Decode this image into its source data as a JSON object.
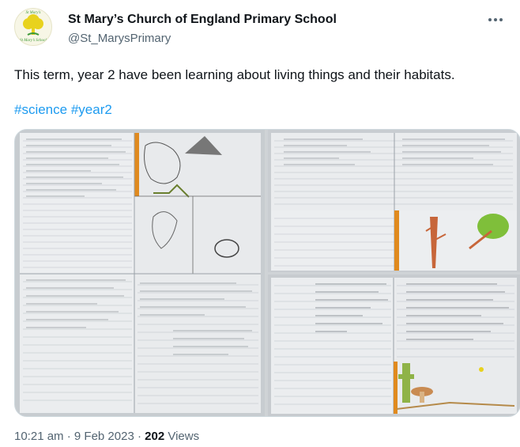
{
  "author": {
    "display_name": "St Mary’s Church of England Primary School",
    "handle": "@St_MarysPrimary",
    "avatar_text_top": "St Mary’s",
    "avatar_text_bottom": "St Mary’s School"
  },
  "post": {
    "text": "This term, year 2 have been learning about living things and their habitats.",
    "hashtags": [
      "#science",
      "#year2"
    ]
  },
  "meta": {
    "time": "10:21 am",
    "separator": "·",
    "date": "9 Feb 2023",
    "views_count": "202",
    "views_label": "Views"
  },
  "icons": {
    "more": "more-horizontal-icon",
    "avatar_tree": "tree-icon"
  },
  "colors": {
    "link": "#1d9bf0",
    "secondary_text": "#536471",
    "avatar_green": "#3f9a39",
    "avatar_yellow": "#e8d21d"
  },
  "media": {
    "photos": [
      {
        "label": "workbook-photo-1"
      },
      {
        "label": "workbook-photo-2"
      },
      {
        "label": "workbook-photo-3"
      }
    ]
  }
}
